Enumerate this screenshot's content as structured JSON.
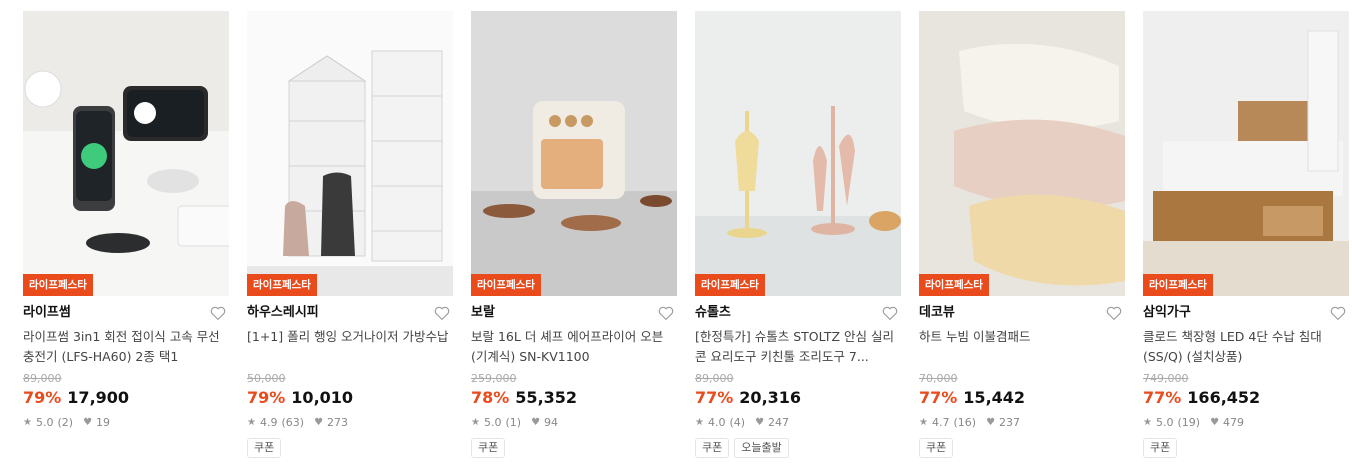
{
  "products": [
    {
      "badge": "라이프페스타",
      "brand": "라이프썸",
      "name": "라이프썸 3in1 회전 접이식 고속 무선충전기 (LFS-HA60) 2종 택1",
      "original_price": "89,000",
      "discount": "79%",
      "price": "17,900",
      "rating": "5.0",
      "reviews": "(2)",
      "likes": "19",
      "tags": []
    },
    {
      "badge": "라이프페스타",
      "brand": "하우스레시피",
      "name": "[1+1] 폴리 행잉 오거나이저 가방수납",
      "original_price": "50,000",
      "discount": "79%",
      "price": "10,010",
      "rating": "4.9",
      "reviews": "(63)",
      "likes": "273",
      "tags": [
        "쿠폰"
      ]
    },
    {
      "badge": "라이프페스타",
      "brand": "보랄",
      "name": "보랄 16L 더 셰프 에어프라이어 오븐 (기계식) SN-KV1100",
      "original_price": "259,000",
      "discount": "78%",
      "price": "55,352",
      "rating": "5.0",
      "reviews": "(1)",
      "likes": "94",
      "tags": [
        "쿠폰"
      ]
    },
    {
      "badge": "라이프페스타",
      "brand": "슈톨츠",
      "name": "[한정특가] 슈톨츠 STOLTZ 안심 실리콘 요리도구 키친툴 조리도구 7...",
      "original_price": "89,000",
      "discount": "77%",
      "price": "20,316",
      "rating": "4.0",
      "reviews": "(4)",
      "likes": "247",
      "tags": [
        "쿠폰",
        "오늘출발"
      ]
    },
    {
      "badge": "라이프페스타",
      "brand": "데코뷰",
      "name": "하트 누빔 이불겸패드",
      "original_price": "70,000",
      "discount": "77%",
      "price": "15,442",
      "rating": "4.7",
      "reviews": "(16)",
      "likes": "237",
      "tags": [
        "쿠폰"
      ]
    },
    {
      "badge": "라이프페스타",
      "brand": "삼익가구",
      "name": "클로드 책장형 LED 4단 수납 침대 (SS/Q) (설치상품)",
      "original_price": "749,000",
      "discount": "77%",
      "price": "166,452",
      "rating": "5.0",
      "reviews": "(19)",
      "likes": "479",
      "tags": [
        "쿠폰"
      ]
    }
  ],
  "icons": {
    "wishlist": "heart-outline-icon",
    "rating": "star-icon",
    "likes": "heart-filled-icon"
  },
  "colors": {
    "accent": "#ea4b1c",
    "price": "#111111",
    "muted": "#888888"
  }
}
